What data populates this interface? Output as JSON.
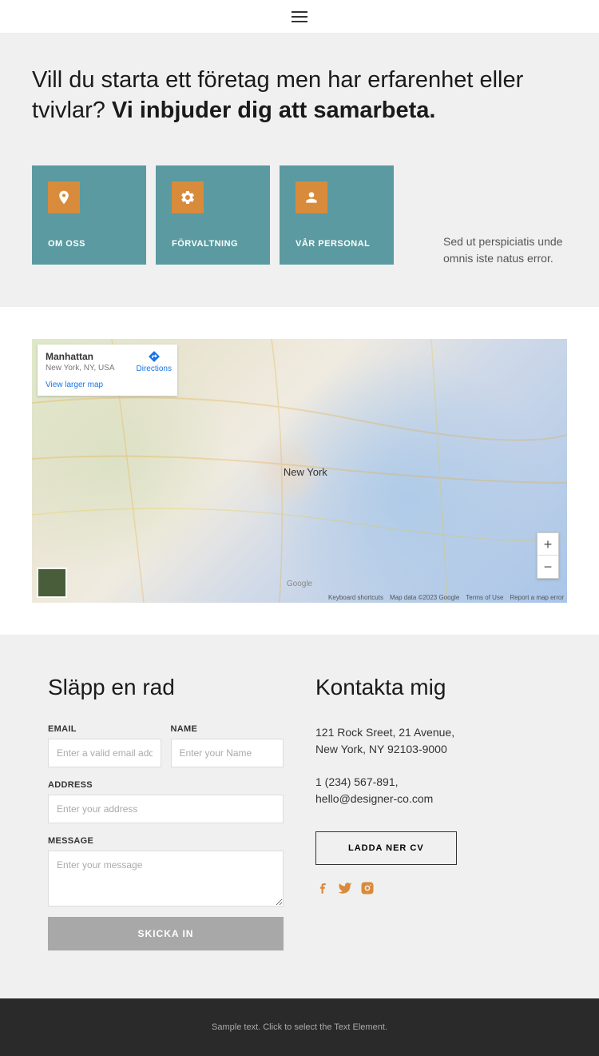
{
  "section1": {
    "heading_light": "Vill du starta ett företag men har erfarenhet eller tvivlar? ",
    "heading_bold": "Vi inbjuder dig att samarbeta.",
    "cards": [
      {
        "label": "OM OSS"
      },
      {
        "label": "FÖRVALTNING"
      },
      {
        "label": "VÅR PERSONAL"
      }
    ],
    "side_text": "Sed ut perspiciatis unde omnis iste natus error."
  },
  "map": {
    "info_title": "Manhattan",
    "info_loc": "New York, NY, USA",
    "info_link": "View larger map",
    "directions": "Directions",
    "city_label": "New York",
    "footer": {
      "shortcuts": "Keyboard shortcuts",
      "data": "Map data ©2023 Google",
      "terms": "Terms of Use",
      "report": "Report a map error"
    },
    "google": "Google"
  },
  "form": {
    "heading": "Släpp en rad",
    "email_label": "EMAIL",
    "email_ph": "Enter a valid email address",
    "name_label": "NAME",
    "name_ph": "Enter your Name",
    "address_label": "ADDRESS",
    "address_ph": "Enter your address",
    "message_label": "MESSAGE",
    "message_ph": "Enter your message",
    "submit": "SKICKA IN"
  },
  "contact": {
    "heading": "Kontakta mig",
    "address": "121 Rock Sreet, 21 Avenue, New York, NY 92103-9000",
    "phone_email": "1 (234) 567-891, hello@designer-co.com",
    "cv_btn": "LADDA NER CV"
  },
  "footer": {
    "text": "Sample text. Click to select the Text Element."
  }
}
